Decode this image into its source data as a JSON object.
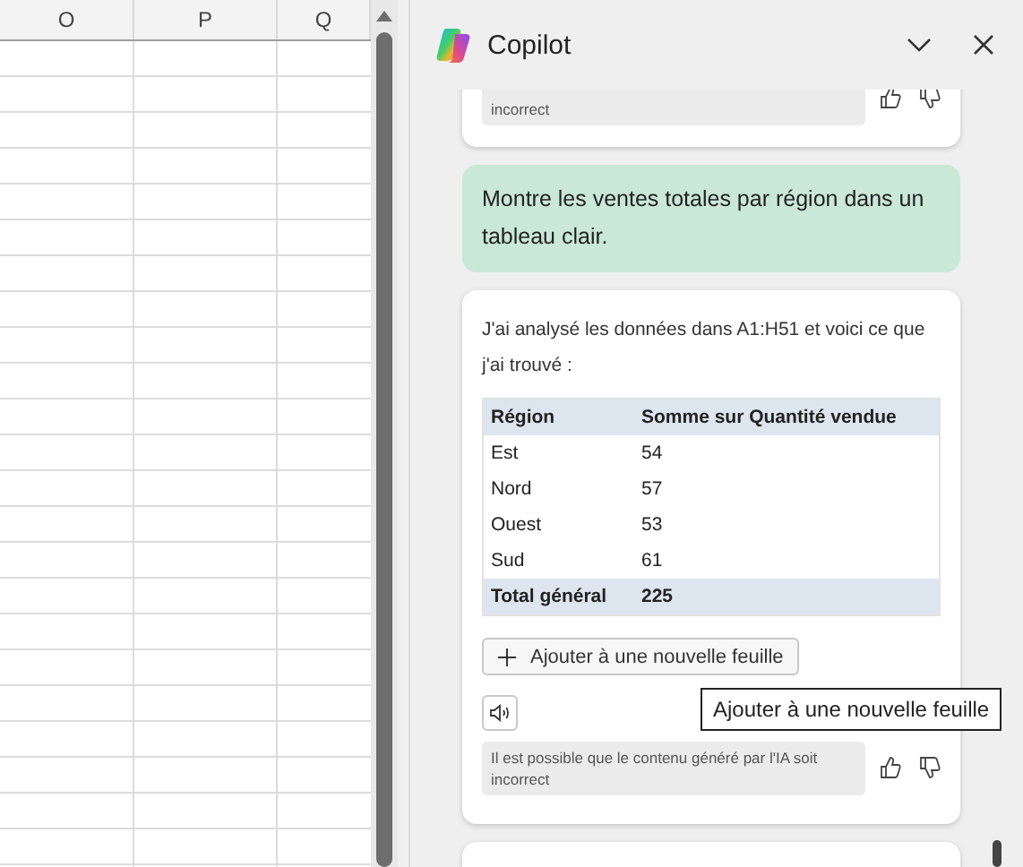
{
  "sheet": {
    "columns": [
      "O",
      "P",
      "Q"
    ]
  },
  "copilot": {
    "title": "Copilot",
    "messages": [
      {
        "kind": "disclaimer_card",
        "disclaimer": "incorrect"
      },
      {
        "kind": "user",
        "text": "Montre les ventes totales par région dans un tableau clair."
      },
      {
        "kind": "response",
        "intro": "J'ai analysé les données dans A1:H51 et voici ce que j'ai trouvé :",
        "table": {
          "columns": [
            "Région",
            "Somme sur Quantité vendue"
          ],
          "rows": [
            [
              "Est",
              "54"
            ],
            [
              "Nord",
              "57"
            ],
            [
              "Ouest",
              "53"
            ],
            [
              "Sud",
              "61"
            ]
          ],
          "total": [
            "Total général",
            "225"
          ]
        },
        "add_button": "Ajouter à une nouvelle feuille",
        "disclaimer": "Il est possible que le contenu généré par l'IA soit incorrect"
      },
      {
        "kind": "empty_card"
      }
    ]
  },
  "tooltip": "Ajouter à une nouvelle feuille"
}
